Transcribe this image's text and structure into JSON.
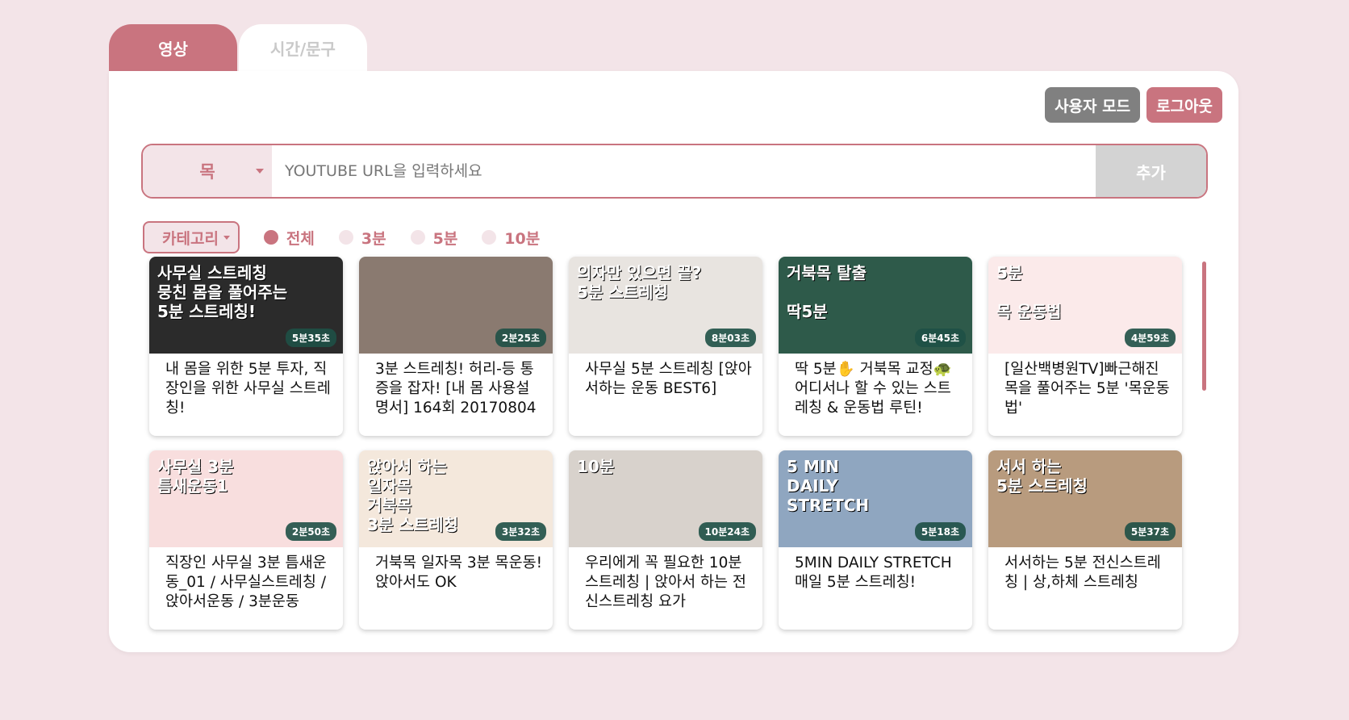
{
  "tabs": [
    {
      "label": "영상"
    },
    {
      "label": "시간/문구"
    }
  ],
  "header": {
    "user_mode": "사용자 모드",
    "logout": "로그아웃"
  },
  "url_bar": {
    "selected": "목",
    "placeholder": "YOUTUBE URL을 입력하세요",
    "add": "추가"
  },
  "filters": {
    "category": "카테고리",
    "options": [
      "전체",
      "3분",
      "5분",
      "10분"
    ],
    "selected": "전체"
  },
  "videos": [
    {
      "title": "내 몸을 위한 5분 투자, 직장인을 위한 사무실 스트레칭!",
      "duration": "5분35초",
      "thumb_text": "사무실 스트레칭\n뭉친 몸을 풀어주는\n5분 스트레칭!",
      "color": "#2b2b2b"
    },
    {
      "title": "3분 스트레칭! 허리-등 통증을 잡자! [내 몸 사용설명서] 164회 20170804",
      "duration": "2분25초",
      "thumb_text": "",
      "color": "#8a7a70"
    },
    {
      "title": "사무실 5분 스트레칭 [앉아서하는 운동 BEST6]",
      "duration": "8분03초",
      "thumb_text": "의자만 있으면 끝?\n5분 스트레칭",
      "color": "#e8e4e0"
    },
    {
      "title": "딱 5분✋ 거북목 교정🐢 어디서나 할 수 있는 스트레칭 & 운동법 루틴!",
      "duration": "6분45초",
      "thumb_text": "거북목 탈출\n\n딱5분",
      "color": "#2e5a4a"
    },
    {
      "title": "[일산백병원TV]빠근해진 목을 풀어주는 5분 '목운동법'",
      "duration": "4분59초",
      "thumb_text": "5분\n\n목 운동법",
      "color": "#fbeaea"
    },
    {
      "title": "직장인 사무실 3분 틈새운동_01 / 사무실스트레칭 / 앉아서운동 / 3분운동",
      "duration": "2분50초",
      "thumb_text": "사무실 3분\n틈새운동1",
      "color": "#f8dede"
    },
    {
      "title": "거북목 일자목 3분 목운동! 앉아서도 OK",
      "duration": "3분32초",
      "thumb_text": "앉아서 하는\n일자목\n거북목\n3분 스트레칭",
      "color": "#f4e8dc"
    },
    {
      "title": "우리에게 꼭 필요한 10분 스트레칭 | 앉아서 하는 전신스트레칭 요가",
      "duration": "10분24초",
      "thumb_text": "10분",
      "color": "#d8d2cc"
    },
    {
      "title": "5MIN DAILY STRETCH 매일 5분 스트레칭!",
      "duration": "5분18초",
      "thumb_text": "5 MIN\nDAILY\nSTRETCH",
      "color": "#8fa6c0"
    },
    {
      "title": "서서하는 5분 전신스트레칭 | 상,하체 스트레칭",
      "duration": "5분37초",
      "thumb_text": "서서 하는\n5분 스트레칭",
      "color": "#b89b7e"
    }
  ]
}
